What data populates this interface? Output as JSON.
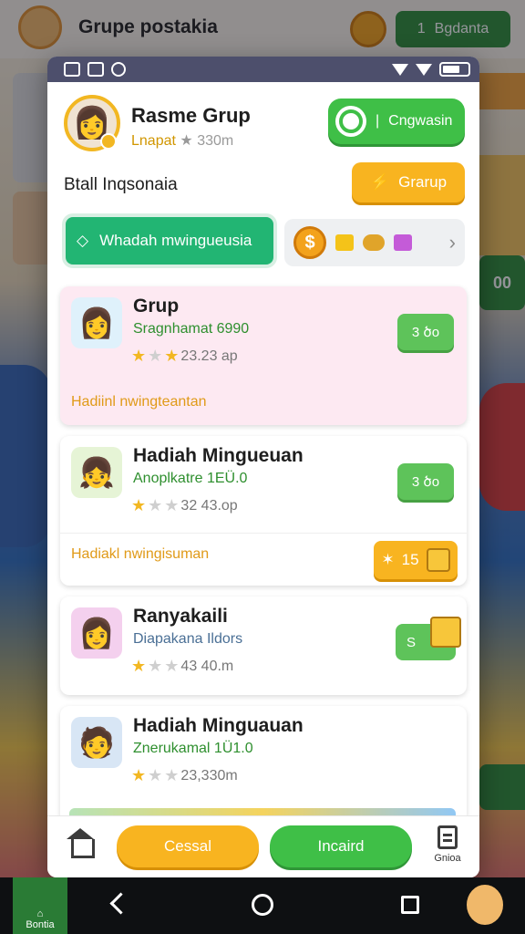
{
  "background": {
    "title": "Grupe postakia",
    "btn_num": "1",
    "btn_label": "Bgdanta",
    "right_badge": "00"
  },
  "profile": {
    "name": "Rasme Grup",
    "level": "Lnapat",
    "stars": "330m",
    "status_button": "Cngwasin"
  },
  "section": {
    "label": "Btall Inqsonaia",
    "grup_button": "Grarup"
  },
  "weekly": {
    "button_label": "Whadah mwingueusia",
    "coin_symbol": "$"
  },
  "cards": [
    {
      "name": "Grup",
      "desc": "Sragnhamat 6990",
      "rating": "23.23 ap",
      "button": "3 ծo",
      "footer": "Hadiinl nwingteantan"
    },
    {
      "name": "Hadiah Mingueuan",
      "desc": "Anoplkatre 1EÜ.0",
      "rating": "32 43.op",
      "button": "3 ծo",
      "footer": "Hadiakl nwingisuman",
      "reward": "15"
    },
    {
      "name": "Ranyakaili",
      "desc": "Diapakana Ildors",
      "rating": "43 40.m",
      "button": "S"
    },
    {
      "name": "Hadiah Minguauan",
      "desc": "Znerukamal 1Ü1.0",
      "rating": "23,330m"
    }
  ],
  "footer": {
    "btn_orange": "Cessal",
    "btn_green": "Incaird",
    "doc_label": "Gnioa"
  },
  "sysnav": {
    "tab_label": "Bontia"
  },
  "colors": {
    "green": "#3fbf47",
    "orange": "#f8b420",
    "teal": "#22b573",
    "pink_card": "#fde9f2"
  }
}
